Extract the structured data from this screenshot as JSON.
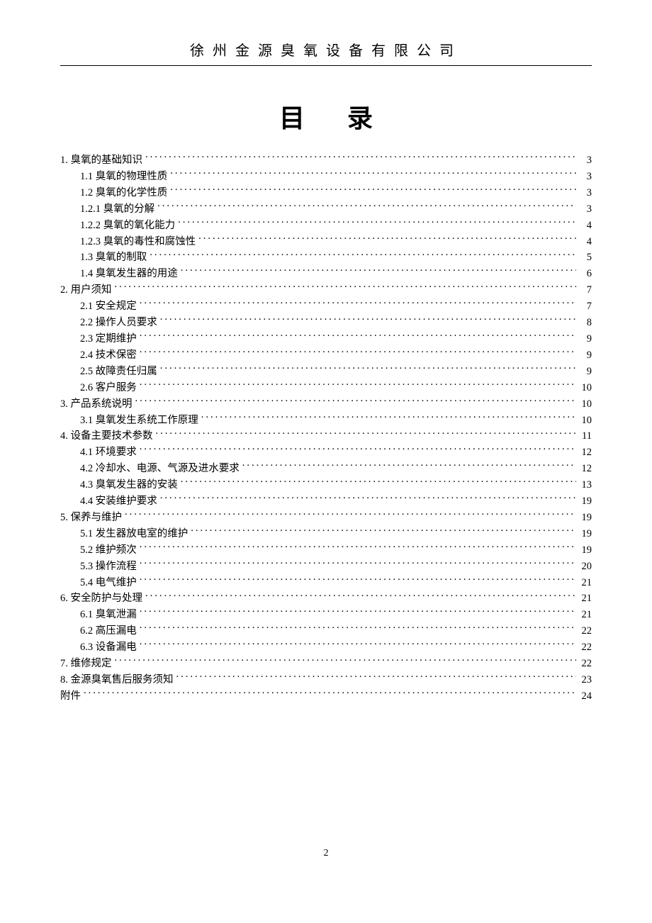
{
  "header": "徐州金源臭氧设备有限公司",
  "title": "目录",
  "page_number": "2",
  "toc": [
    {
      "level": 0,
      "label": "1. 臭氧的基础知识",
      "page": "3"
    },
    {
      "level": 1,
      "label": "1.1 臭氧的物理性质",
      "page": "3"
    },
    {
      "level": 1,
      "label": "1.2 臭氧的化学性质",
      "page": "3"
    },
    {
      "level": 1,
      "label": "1.2.1 臭氧的分解",
      "page": "3"
    },
    {
      "level": 1,
      "label": "1.2.2 臭氧的氧化能力",
      "page": "4"
    },
    {
      "level": 1,
      "label": "1.2.3 臭氧的毒性和腐蚀性",
      "page": "4"
    },
    {
      "level": 1,
      "label": "1.3 臭氧的制取",
      "page": "5"
    },
    {
      "level": 1,
      "label": "1.4 臭氧发生器的用途",
      "page": "6"
    },
    {
      "level": 0,
      "label": "2. 用户须知",
      "page": "7"
    },
    {
      "level": 1,
      "label": "2.1 安全规定",
      "page": "7"
    },
    {
      "level": 1,
      "label": "2.2 操作人员要求",
      "page": "8"
    },
    {
      "level": 1,
      "label": "2.3 定期维护",
      "page": "9"
    },
    {
      "level": 1,
      "label": "2.4 技术保密",
      "page": "9"
    },
    {
      "level": 1,
      "label": "2.5 故障责任归属",
      "page": "9"
    },
    {
      "level": 1,
      "label": "2.6 客户服务",
      "page": "10"
    },
    {
      "level": 0,
      "label": "3. 产品系统说明",
      "page": "10"
    },
    {
      "level": 1,
      "label": "3.1 臭氧发生系统工作原理",
      "page": "10"
    },
    {
      "level": 0,
      "label": "4. 设备主要技术参数",
      "page": "11"
    },
    {
      "level": 1,
      "label": "4.1 环境要求",
      "page": "12"
    },
    {
      "level": 1,
      "label": "4.2 冷却水、电源、气源及进水要求",
      "page": "12"
    },
    {
      "level": 1,
      "label": "4.3 臭氧发生器的安装",
      "page": "13"
    },
    {
      "level": 1,
      "label": "4.4 安装维护要求",
      "page": "19"
    },
    {
      "level": 0,
      "label": "5. 保养与维护",
      "page": "19"
    },
    {
      "level": 1,
      "label": "5.1 发生器放电室的维护",
      "page": "19"
    },
    {
      "level": 1,
      "label": "5.2 维护频次",
      "page": "19"
    },
    {
      "level": 1,
      "label": "5.3 操作流程",
      "page": "20"
    },
    {
      "level": 1,
      "label": "5.4 电气维护",
      "page": "21"
    },
    {
      "level": 0,
      "label": "6. 安全防护与处理",
      "page": "21"
    },
    {
      "level": 1,
      "label": "6.1 臭氧泄漏",
      "page": "21"
    },
    {
      "level": 1,
      "label": "6.2 高压漏电",
      "page": "22"
    },
    {
      "level": 1,
      "label": "6.3 设备漏电",
      "page": "22"
    },
    {
      "level": 0,
      "label": "7. 维修规定",
      "page": "22"
    },
    {
      "level": 0,
      "label": "8. 金源臭氧售后服务须知",
      "page": "23"
    },
    {
      "level": 0,
      "label": "附件",
      "page": "24"
    }
  ]
}
